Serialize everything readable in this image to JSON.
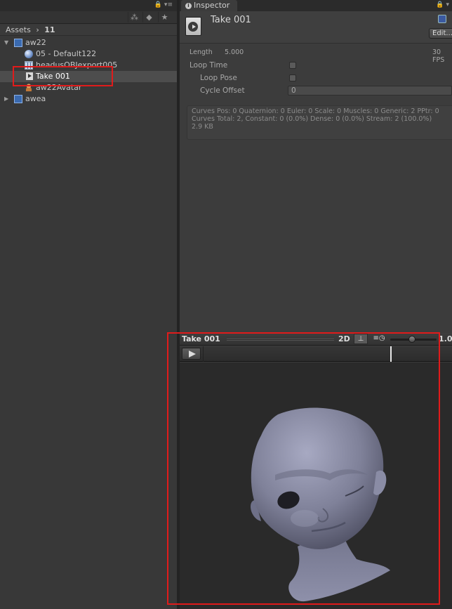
{
  "project": {
    "breadcrumb_root": "Assets",
    "breadcrumb_sep": "›",
    "breadcrumb_folder": "11",
    "tree": [
      {
        "label": "aw22",
        "icon": "prefab-cube-icon",
        "expanded": true
      },
      {
        "label": "05 - Default122",
        "icon": "material-sphere-icon"
      },
      {
        "label": "headusOBJexport005",
        "icon": "mesh-grid-icon"
      },
      {
        "label": "Take 001",
        "icon": "animation-clip-icon",
        "selected": true
      },
      {
        "label": "aw22Avatar",
        "icon": "avatar-icon"
      },
      {
        "label": "awea",
        "icon": "prefab-cube-icon",
        "expanded": false
      }
    ]
  },
  "inspector": {
    "tab_label": "Inspector",
    "title": "Take 001",
    "edit_label": "Edit...",
    "length_label": "Length",
    "length_value": "5.000",
    "fps_value": "30 FPS",
    "loop_time_label": "Loop Time",
    "loop_pose_label": "Loop Pose",
    "cycle_offset_label": "Cycle Offset",
    "cycle_offset_value": "0",
    "stats_line1": "Curves Pos: 0 Quaternion: 0 Euler: 0 Scale: 0 Muscles: 0 Generic: 2 PPtr: 0",
    "stats_line2": "Curves Total: 2, Constant: 0 (0.0%) Dense: 0 (0.0%) Stream: 2 (100.0%)",
    "stats_line3": "2.9 KB"
  },
  "preview": {
    "title": "Take 001",
    "mode_2d": "2D",
    "speed_value": "1.00",
    "playhead_fraction": 0.75
  },
  "colors": {
    "highlight": "#e01b1b",
    "panel": "#383838",
    "viewport": "#2a2a2a"
  }
}
